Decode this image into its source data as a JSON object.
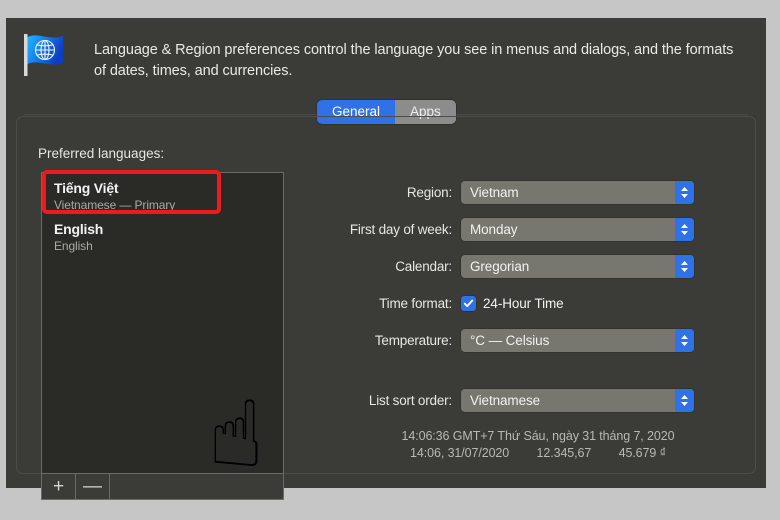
{
  "header": {
    "icon": "globe-flag-icon",
    "description": "Language & Region preferences control the language you see in menus and dialogs, and the formats of dates, times, and currencies."
  },
  "tabs": [
    {
      "label": "General",
      "active": true
    },
    {
      "label": "Apps",
      "active": false
    }
  ],
  "languages_section": {
    "label": "Preferred languages:",
    "items": [
      {
        "name": "Tiếng Việt",
        "sub": "Vietnamese — Primary",
        "highlighted": true
      },
      {
        "name": "English",
        "sub": "English",
        "highlighted": false
      }
    ],
    "toolbar": {
      "add_label": "+",
      "remove_label": "—"
    },
    "pointer_emoji": "☝"
  },
  "form": {
    "rows": [
      {
        "label": "Region:",
        "value": "Vietnam",
        "type": "select"
      },
      {
        "label": "First day of week:",
        "value": "Monday",
        "type": "select"
      },
      {
        "label": "Calendar:",
        "value": "Gregorian",
        "type": "select"
      },
      {
        "label": "Time format:",
        "value": "24-Hour Time",
        "type": "checkbox",
        "checked": true
      },
      {
        "label": "Temperature:",
        "value": "°C — Celsius",
        "type": "select"
      },
      {
        "label": "List sort order:",
        "value": "Vietnamese",
        "type": "select"
      }
    ]
  },
  "preview": {
    "line1": "14:06:36 GMT+7 Thứ Sáu, ngày 31 tháng 7, 2020",
    "time": "14:06, 31/07/2020",
    "number": "12.345,67",
    "currency": "45.679 ₫"
  },
  "colors": {
    "accent_blue": "#2f72e8",
    "window_bg": "#3b3b37",
    "listbox_bg": "#2a2a27",
    "select_bg": "#77776f",
    "annotation_red": "#ef1b1b",
    "frame_gray": "#c6c6c6"
  }
}
